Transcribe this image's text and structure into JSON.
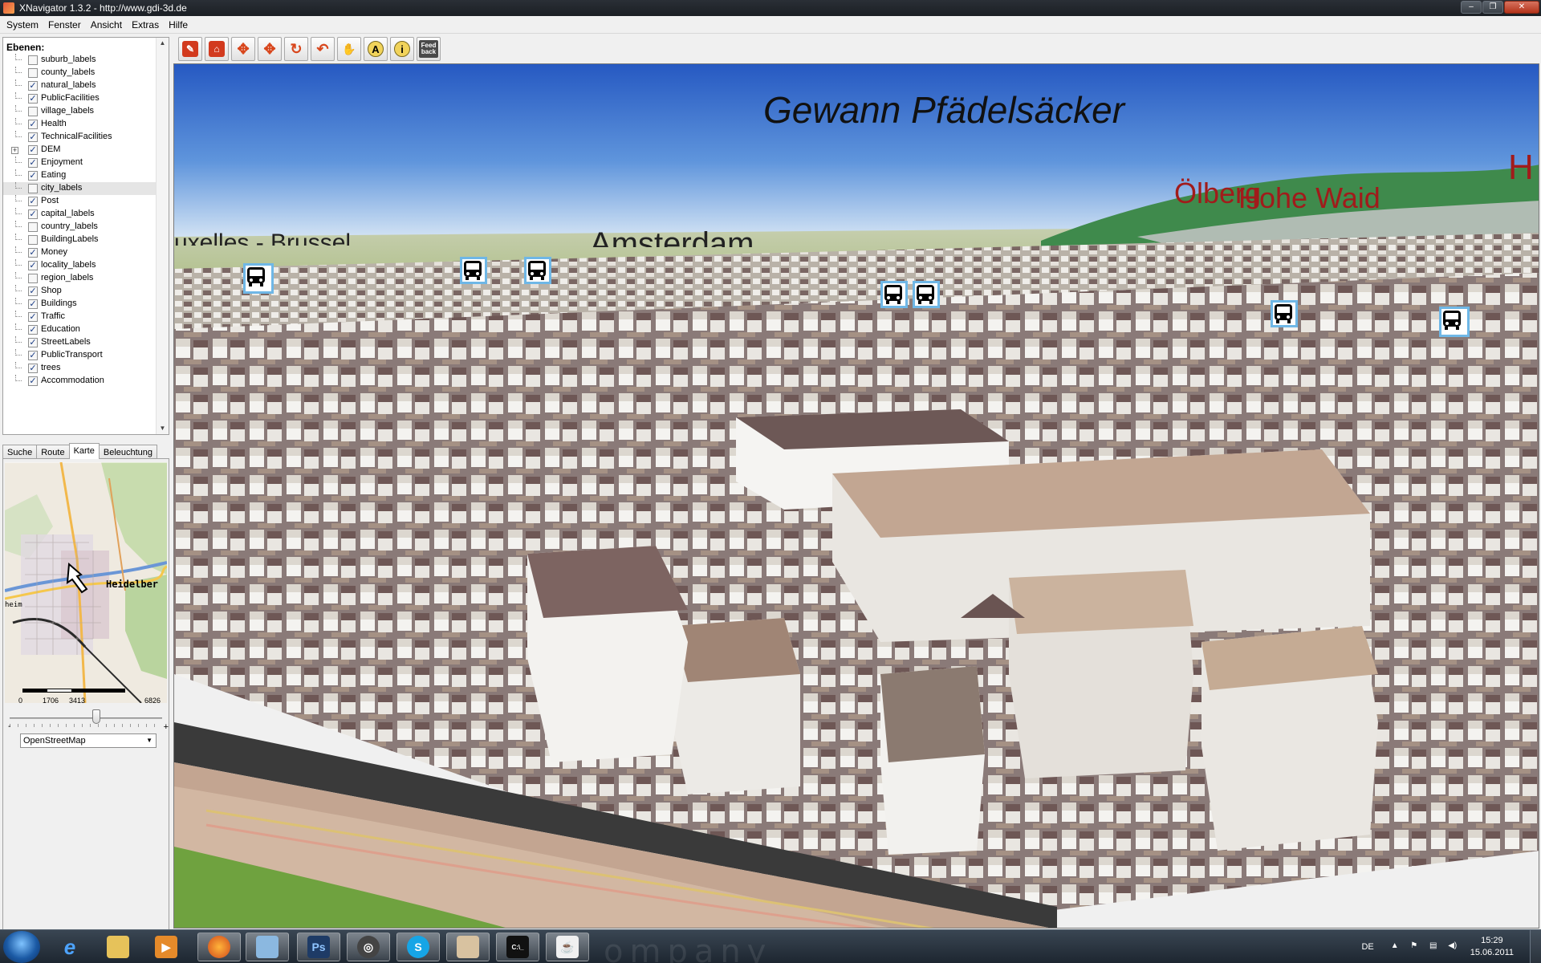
{
  "window": {
    "title": "XNavigator 1.3.2 - http://www.gdi-3d.de",
    "buttons": [
      "–",
      "❐",
      "✕"
    ]
  },
  "menu": [
    "System",
    "Fenster",
    "Ansicht",
    "Extras",
    "Hilfe"
  ],
  "layers_panel": {
    "heading": "Ebenen:",
    "layers": [
      {
        "label": "suburb_labels",
        "checked": false
      },
      {
        "label": "county_labels",
        "checked": false
      },
      {
        "label": "natural_labels",
        "checked": true
      },
      {
        "label": "PublicFacilities",
        "checked": true
      },
      {
        "label": "village_labels",
        "checked": false
      },
      {
        "label": "Health",
        "checked": true
      },
      {
        "label": "TechnicalFacilities",
        "checked": true
      },
      {
        "label": "DEM",
        "checked": true,
        "expandable": true
      },
      {
        "label": "Enjoyment",
        "checked": true
      },
      {
        "label": "Eating",
        "checked": true
      },
      {
        "label": "city_labels",
        "checked": false,
        "selected": true
      },
      {
        "label": "Post",
        "checked": true
      },
      {
        "label": "capital_labels",
        "checked": true
      },
      {
        "label": "country_labels",
        "checked": false
      },
      {
        "label": "BuildingLabels",
        "checked": false
      },
      {
        "label": "Money",
        "checked": true
      },
      {
        "label": "locality_labels",
        "checked": true
      },
      {
        "label": "region_labels",
        "checked": false
      },
      {
        "label": "Shop",
        "checked": true
      },
      {
        "label": "Buildings",
        "checked": true
      },
      {
        "label": "Traffic",
        "checked": true
      },
      {
        "label": "Education",
        "checked": true
      },
      {
        "label": "StreetLabels",
        "checked": true
      },
      {
        "label": "PublicTransport",
        "checked": true
      },
      {
        "label": "trees",
        "checked": true
      },
      {
        "label": "Accommodation",
        "checked": true
      }
    ]
  },
  "tabs": [
    {
      "label": "Suche",
      "active": false
    },
    {
      "label": "Route",
      "active": false
    },
    {
      "label": "Karte",
      "active": true
    },
    {
      "label": "Beleuchtung",
      "active": false
    }
  ],
  "minimap": {
    "place_label": "Heidelber",
    "west_label": "heim",
    "scale_ticks": [
      "0",
      "1706",
      "3413",
      "6826"
    ],
    "zoom_minus": "-",
    "zoom_plus": "+",
    "zoom_level": 0.57,
    "basemap": "OpenStreetMap"
  },
  "toolbar": {
    "tools": [
      {
        "name": "pan-red-tool",
        "glyph": "✎"
      },
      {
        "name": "home-tool",
        "glyph": "⌂"
      },
      {
        "name": "move-up-tool",
        "glyph": "✥"
      },
      {
        "name": "move-tool",
        "glyph": "✥"
      },
      {
        "name": "rotate-tool",
        "glyph": "↻"
      },
      {
        "name": "undo-tool",
        "glyph": "↶"
      },
      {
        "name": "hand-tool",
        "glyph": "✋"
      },
      {
        "name": "label-tool",
        "glyph": "A"
      },
      {
        "name": "info-tool",
        "glyph": "i"
      }
    ],
    "feedback_label": "Feed back"
  },
  "scene": {
    "labels": {
      "gewann": "Gewann Pfädelsäcker",
      "olberg": "Ölberg",
      "hohe_waid": "Hohe Waid",
      "brussels": "uxelles - Brussel",
      "amsterdam": "Amsterdam",
      "partial_h": "H"
    },
    "colors": {
      "sky_top": "#2a63c8",
      "sky_horizon": "#d3e3f3",
      "place_red": "#a11b1b",
      "bus_border": "#6fb7e6"
    }
  },
  "taskbar": {
    "watermark": "ompany",
    "apps": [
      "windows-start",
      "internet-explorer",
      "file-explorer",
      "media-player",
      "firefox",
      "image-viewer",
      "photoshop",
      "app-circle",
      "skype",
      "paint",
      "command-prompt",
      "java"
    ],
    "ps_text": "Ps",
    "cmd_text": "C:\\_",
    "lang": "DE",
    "time": "15:29",
    "date": "15.06.2011"
  }
}
